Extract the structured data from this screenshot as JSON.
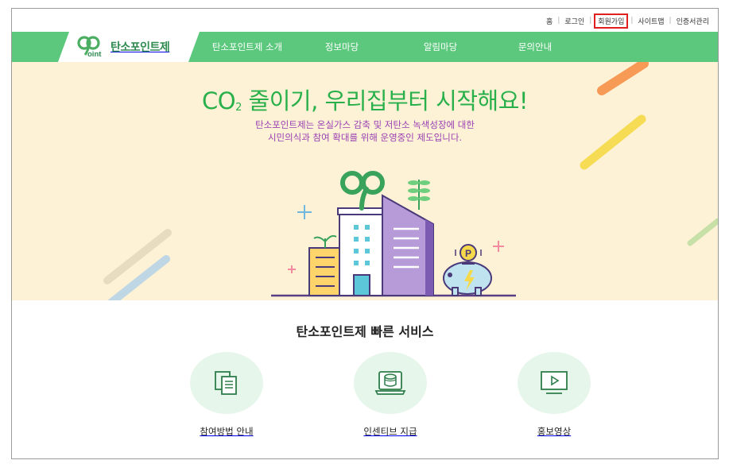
{
  "util_links": [
    "홈",
    "로그인",
    "회원가입",
    "사이트맵",
    "인증서관리"
  ],
  "logo": {
    "mark_text": "oint",
    "name": "탄소포인트제"
  },
  "nav": {
    "menu": [
      "탄소포인트제 소개",
      "정보마당",
      "알림마당",
      "문의안내"
    ]
  },
  "hero": {
    "title_pre": "CO",
    "title_sub": "2",
    "title_post": " 줄이기, 우리집부터 시작해요!",
    "desc_line1": "탄소포인트제는 온실가스 감축 및 저탄소 녹색성장에 대한",
    "desc_line2": "시민의식과 참여 확대를 위해 운영중인 제도입니다.",
    "coin_letter": "P"
  },
  "quick_services": {
    "title": "탄소포인트제 빠른 서비스",
    "items": [
      {
        "label": "참여방법 안내",
        "icon": "documents-icon"
      },
      {
        "label": "인센티브 지급",
        "icon": "coin-stack-icon"
      },
      {
        "label": "홍보영상",
        "icon": "video-play-icon"
      }
    ]
  },
  "colors": {
    "nav_green": "#5cc87d",
    "hero_bg": "#fdf2d6",
    "title_green": "#29b04a",
    "desc_purple": "#9a3fb3",
    "highlight_red": "#e02020"
  }
}
